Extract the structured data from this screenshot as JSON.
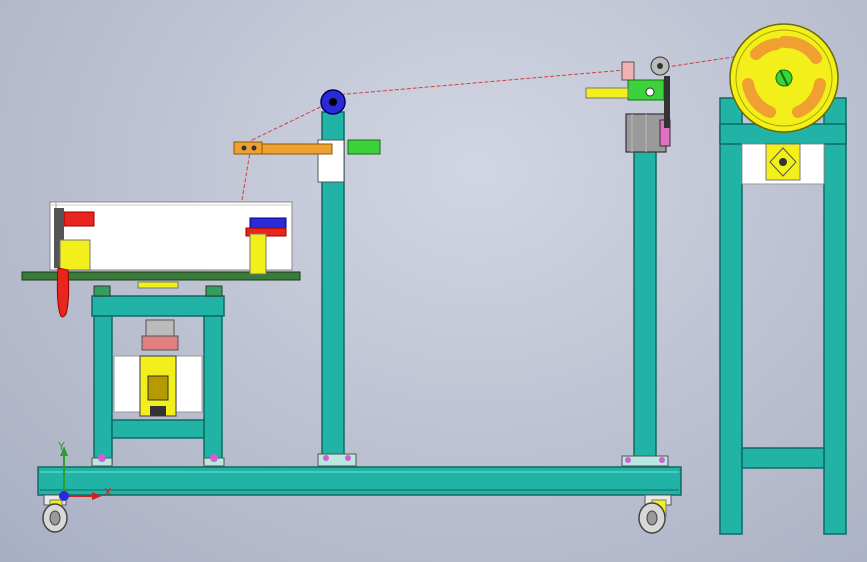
{
  "viewport": {
    "background_top": "#d2d6e2",
    "background_bottom": "#a9afc3"
  },
  "colors": {
    "frame": "#20b3a6",
    "frame_edge": "#0f6b63",
    "yellow": "#f2ef1a",
    "orange": "#f0a030",
    "green": "#3cd23c",
    "red": "#e8261d",
    "blue": "#2a2ad8",
    "white_part": "#ffffff",
    "motor_gray": "#8c8c8c",
    "magenta": "#d060d0",
    "wire": "#d04040"
  },
  "triad": {
    "y_label": "Y",
    "x_label": "X"
  }
}
